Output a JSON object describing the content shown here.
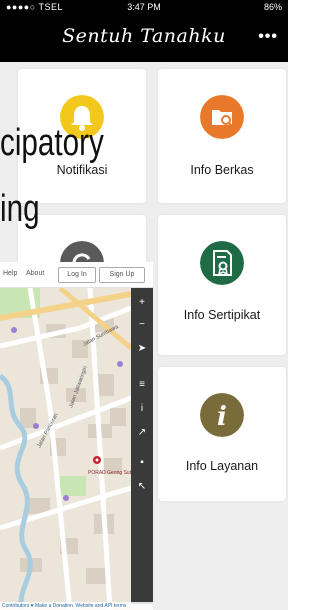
{
  "status_bar": {
    "carrier": "●●●●○ TSEL",
    "time": "3:47 PM",
    "battery": "86%"
  },
  "header": {
    "title": "Sentuh Tanahku",
    "menu_glyph": "•••"
  },
  "cards": [
    {
      "label": "Notifikasi",
      "icon": "bell-icon",
      "color": "#f2c81c"
    },
    {
      "label": "Info Berkas",
      "icon": "folder-icon",
      "color": "#e8792b"
    },
    {
      "label": "",
      "icon": "refresh-icon",
      "color": "#5a5a5a"
    },
    {
      "label": "Info Sertipikat",
      "icon": "certificate-icon",
      "color": "#1e6b45"
    },
    {
      "label": "Info Layanan",
      "icon": "info-icon",
      "color": "#7a6b3a"
    }
  ],
  "overlay": {
    "line1": "cipatory",
    "line2": "ing"
  },
  "map": {
    "help": "Help",
    "about": "About",
    "login": "Log In",
    "signup": "Sign Up",
    "streets": [
      "Jalan Jatiwaringin",
      "Jalan Pancoran",
      "Jalan Sumbawa"
    ],
    "poi_label": "PORAD\nGeong Sutomo",
    "attribution": "Contributors ♥ Make a Donation. Website and API terms",
    "colors": {
      "water": "#a9cde0",
      "park": "#c8e6b3",
      "road": "#ffffff",
      "main_road": "#f5d28a"
    }
  }
}
